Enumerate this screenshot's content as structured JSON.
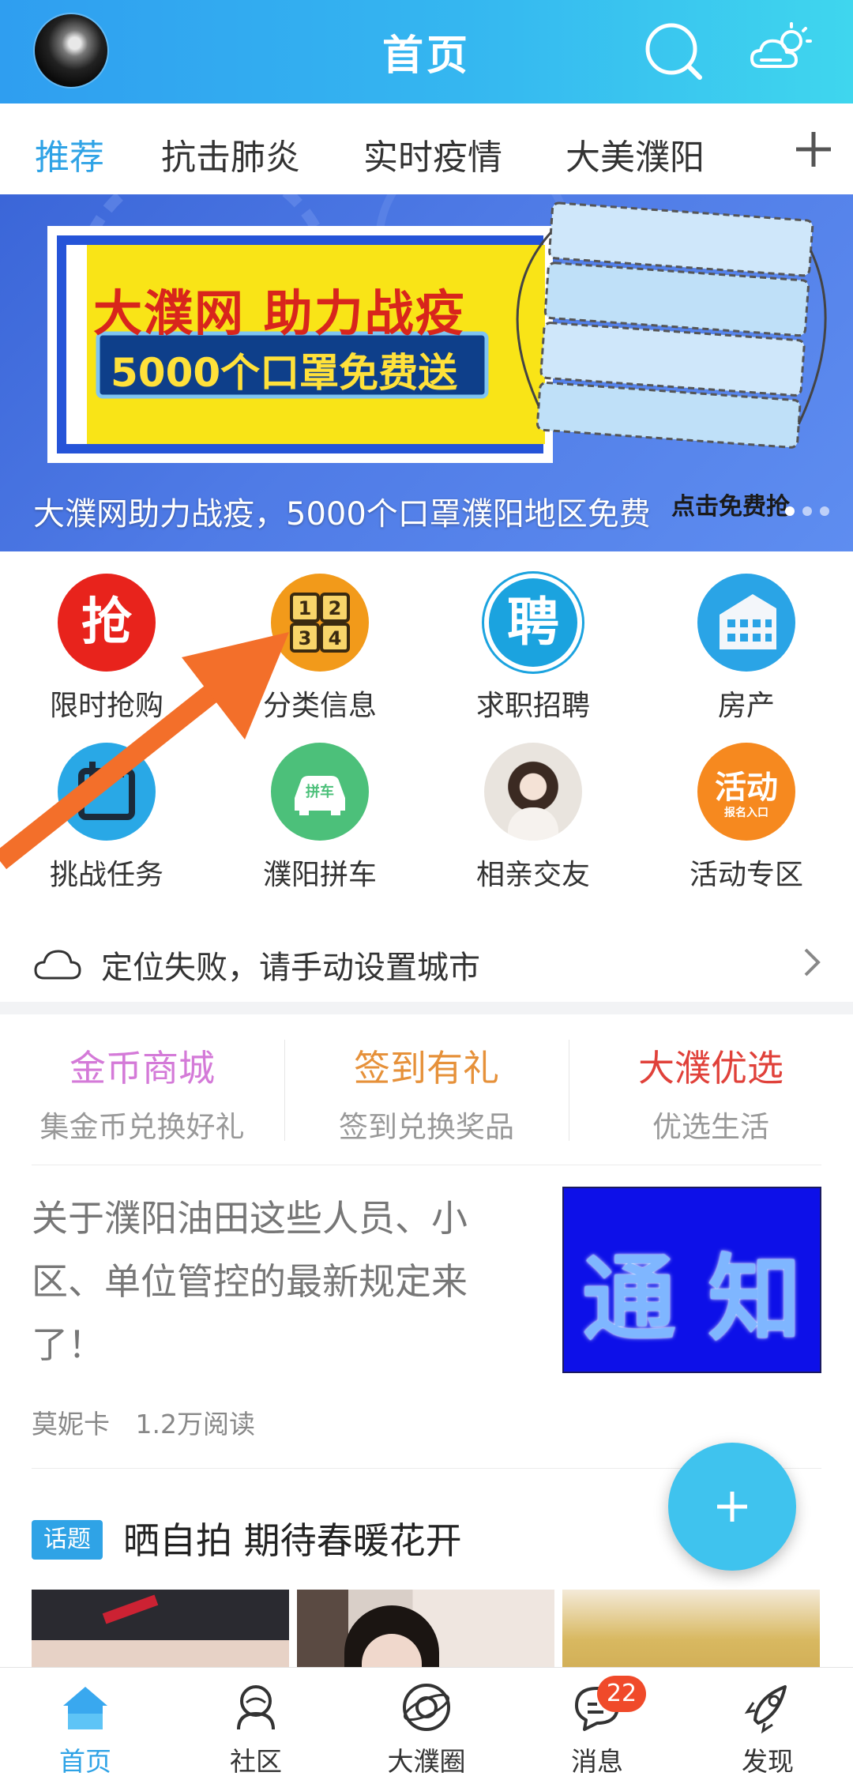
{
  "header": {
    "title": "首页"
  },
  "tabs": [
    {
      "label": "推荐"
    },
    {
      "label": "抗击肺炎"
    },
    {
      "label": "实时疫情"
    },
    {
      "label": "大美濮阳"
    }
  ],
  "banner": {
    "headline": "大濮网 助力战疫",
    "subline": "5000个口罩免费送",
    "side_text": "点击免费抢",
    "caption": "大濮网助力战疫，5000个口罩濮阳地区免费"
  },
  "shortcuts": [
    {
      "label": "限时抢购",
      "glyph": "抢",
      "icon": "flash-sale-icon",
      "color": "#e8231c"
    },
    {
      "label": "分类信息",
      "glyph": "1 2 3 4",
      "icon": "category-icon",
      "color": "#f29a1a"
    },
    {
      "label": "求职招聘",
      "glyph": "聘",
      "icon": "job-icon",
      "color": "#1ba3df"
    },
    {
      "label": "房产",
      "glyph": "",
      "icon": "building-icon",
      "color": "#2aa4e6"
    },
    {
      "label": "挑战任务",
      "glyph": "",
      "icon": "calendar-icon",
      "color": "#29a8e6"
    },
    {
      "label": "濮阳拼车",
      "glyph": "拼车",
      "icon": "car-icon",
      "color": "#4cc07a"
    },
    {
      "label": "相亲交友",
      "glyph": "",
      "icon": "portrait-icon",
      "color": "#d8d0c8"
    },
    {
      "label": "活动专区",
      "glyph": "活动",
      "icon": "event-icon",
      "color": "#f6891f"
    }
  ],
  "shortcut_extra": {
    "event_sub": "报名入口"
  },
  "location": {
    "text": "定位失败，请手动设置城市"
  },
  "cells": [
    {
      "title": "金币商城",
      "subtitle": "集金币兑换好礼",
      "color": "#d47ad8"
    },
    {
      "title": "签到有礼",
      "subtitle": "签到兑换奖品",
      "color": "#e6913a"
    },
    {
      "title": "大濮优选",
      "subtitle": "优选生活",
      "color": "#e0413a"
    }
  ],
  "news": {
    "title": "关于濮阳油田这些人员、小区、单位管控的最新规定来了！",
    "author": "莫妮卡",
    "reads": "1.2万阅读",
    "thumb_text": "通 知"
  },
  "topic": {
    "tag": "话题",
    "title": "晒自拍  期待春暖花开"
  },
  "bottom_nav": [
    {
      "label": "首页",
      "icon": "home-icon",
      "active": true
    },
    {
      "label": "社区",
      "icon": "community-icon"
    },
    {
      "label": "大濮圈",
      "icon": "planet-icon"
    },
    {
      "label": "消息",
      "icon": "message-icon",
      "badge": "22"
    },
    {
      "label": "发现",
      "icon": "rocket-icon"
    }
  ],
  "colors": {
    "accent": "#2fa3e6",
    "header_start": "#2f9ef0",
    "header_end": "#3fd6ee",
    "arrow": "#f36f2a"
  }
}
